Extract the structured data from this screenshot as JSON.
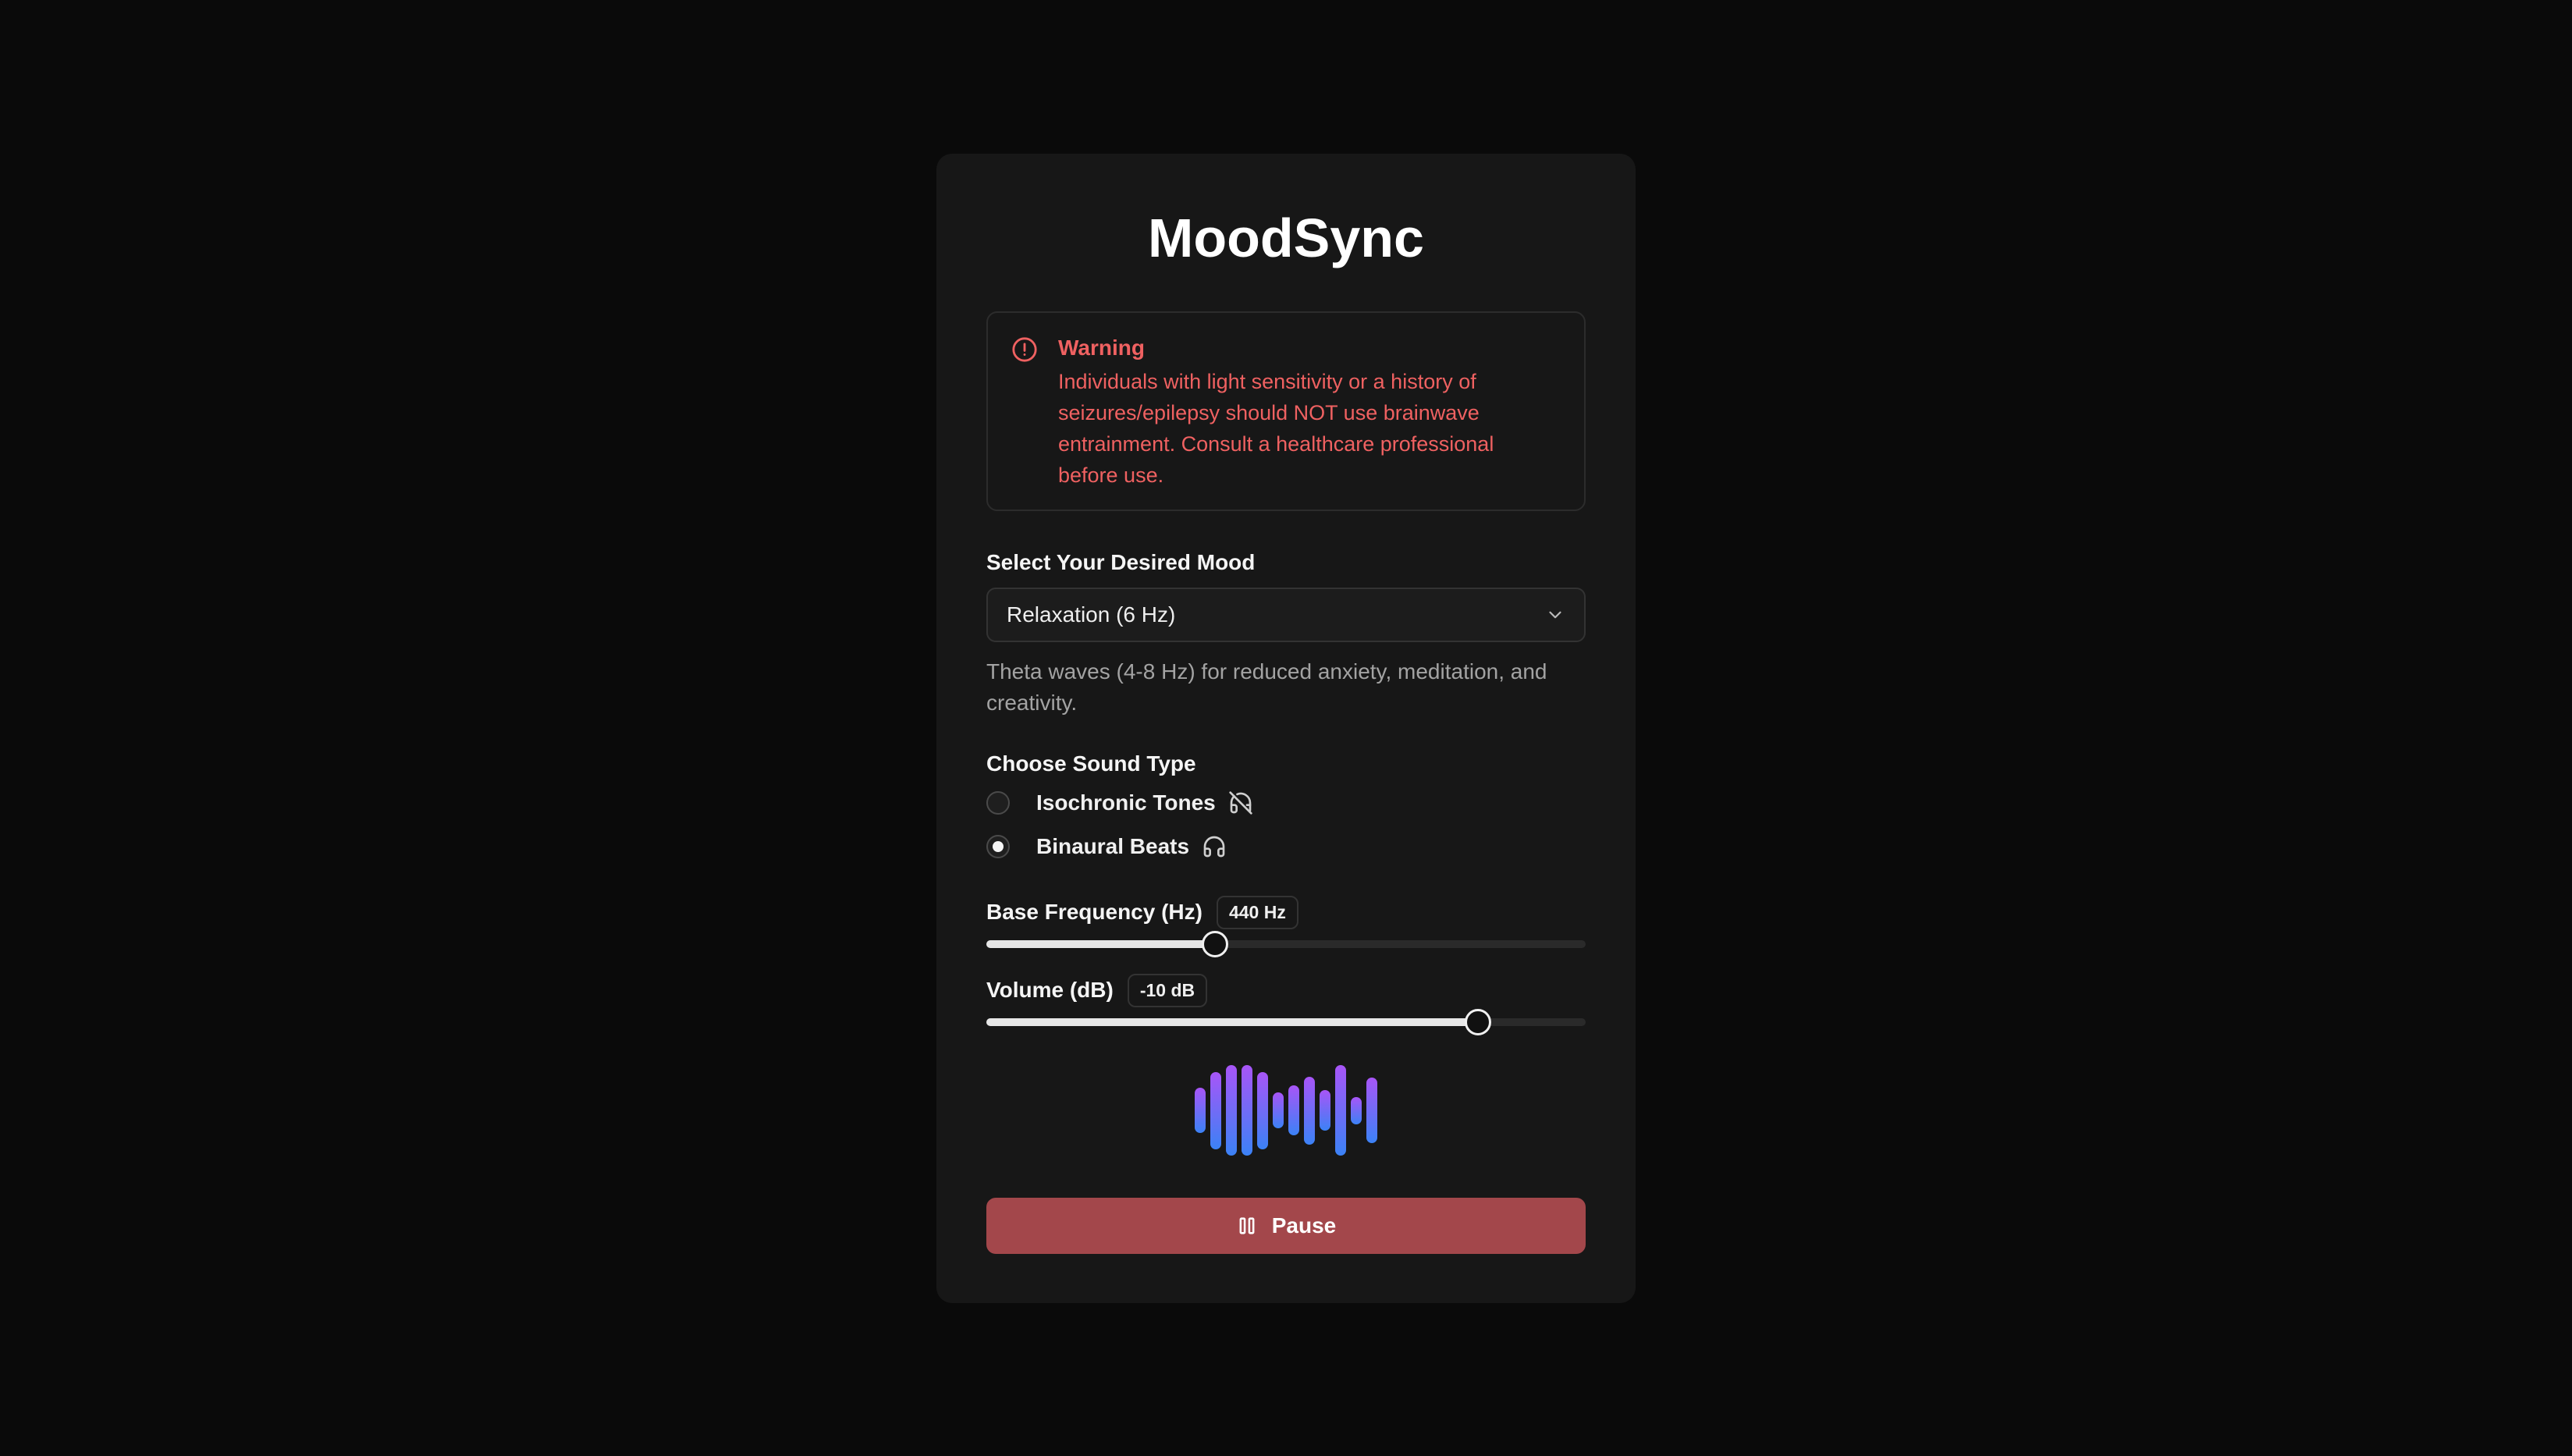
{
  "app": {
    "title": "MoodSync"
  },
  "warning": {
    "heading": "Warning",
    "text": "Individuals with light sensitivity or a history of seizures/epilepsy should NOT use brainwave entrainment. Consult a healthcare professional before use."
  },
  "mood": {
    "label": "Select Your Desired Mood",
    "selected": "Relaxation (6 Hz)",
    "description": "Theta waves (4-8 Hz) for reduced anxiety, meditation, and creativity."
  },
  "sound": {
    "label": "Choose Sound Type",
    "options": [
      {
        "label": "Isochronic Tones",
        "selected": false,
        "icon": "headphones-off-icon"
      },
      {
        "label": "Binaural Beats",
        "selected": true,
        "icon": "headphones-icon"
      }
    ]
  },
  "frequency": {
    "label": "Base Frequency (Hz)",
    "value_label": "440 Hz",
    "fraction": 0.382
  },
  "volume": {
    "label": "Volume (dB)",
    "value_label": "-10 dB",
    "fraction": 0.82
  },
  "visualizer": {
    "levels": [
      0.5,
      0.85,
      1.0,
      1.0,
      0.85,
      0.4,
      0.55,
      0.75,
      0.45,
      1.0,
      0.3,
      0.72
    ]
  },
  "controls": {
    "pause_label": "Pause",
    "pause_icon": "pause-icon"
  },
  "colors": {
    "accent": "#a3474b",
    "warning": "#ef6161",
    "viz_top": "#a855f7",
    "viz_bottom": "#3b82f6"
  }
}
